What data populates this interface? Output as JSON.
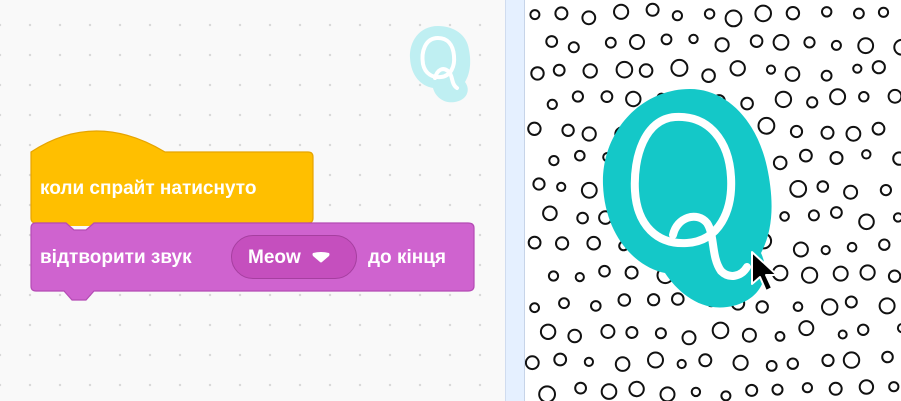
{
  "code_area": {
    "hat_block": {
      "label": "коли спрайт натиснуто",
      "color": "#ffbf00"
    },
    "sound_block": {
      "label": "відтворити звук",
      "dropdown_value": "Meow",
      "suffix": "до кінця",
      "color": "#cf63cf"
    },
    "sprite_thumbnail": {
      "icon": "letter-q-sprite-icon",
      "color": "#bdeef0"
    }
  },
  "stage": {
    "background": "polka-dot-backdrop",
    "sprite": {
      "icon": "letter-q-sprite-icon",
      "color": "#1fc8c8"
    },
    "cursor": "mouse-pointer-icon"
  }
}
